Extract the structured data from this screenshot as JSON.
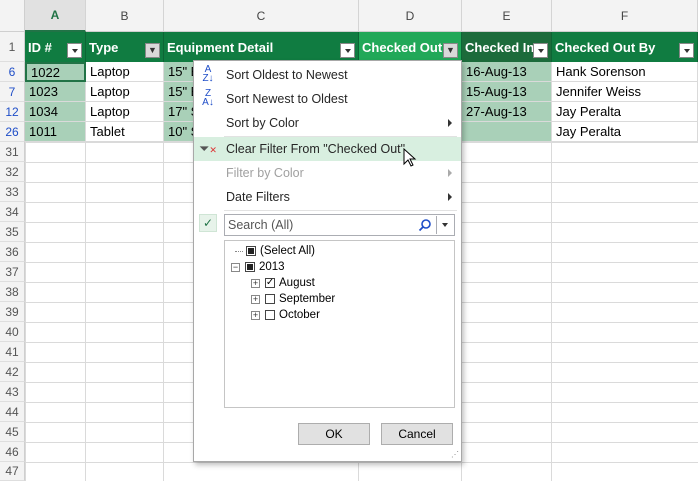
{
  "columns": [
    "A",
    "B",
    "C",
    "D",
    "E",
    "F"
  ],
  "rows": [
    "1",
    "6",
    "7",
    "12",
    "26",
    "31",
    "32",
    "33",
    "34",
    "35",
    "36",
    "37",
    "38",
    "39",
    "40",
    "41",
    "42",
    "43",
    "44",
    "45",
    "46",
    "47"
  ],
  "headers": {
    "id": "ID #",
    "type": "Type",
    "equipment": "Equipment Detail",
    "checked_out": "Checked Out",
    "checked_in": "Checked In",
    "checked_out_by": "Checked Out By"
  },
  "data": [
    {
      "id": "1022",
      "type": "Laptop",
      "equip": "15\" E",
      "in": "16-Aug-13",
      "by": "Hank Sorenson"
    },
    {
      "id": "1023",
      "type": "Laptop",
      "equip": "15\" E",
      "in": "15-Aug-13",
      "by": "Jennifer Weiss"
    },
    {
      "id": "1034",
      "type": "Laptop",
      "equip": "17\" S",
      "in": "27-Aug-13",
      "by": "Jay Peralta"
    },
    {
      "id": "1011",
      "type": "Tablet",
      "equip": "10\" S",
      "in": "",
      "by": "Jay Peralta"
    }
  ],
  "menu": {
    "sort_asc": "Sort Oldest to Newest",
    "sort_desc": "Sort Newest to Oldest",
    "sort_color": "Sort by Color",
    "clear_filter": "Clear Filter From \"Checked Out\"",
    "filter_color": "Filter by Color",
    "date_filters": "Date Filters",
    "search_value": "Search (All)",
    "tree": {
      "select_all": "(Select All)",
      "year": "2013",
      "months": [
        "August",
        "September",
        "October"
      ]
    },
    "ok": "OK",
    "cancel": "Cancel"
  },
  "icons": {
    "sort_asc": "sort-oldest-newest-icon",
    "sort_desc": "sort-newest-oldest-icon",
    "clear": "clear-filter-icon",
    "search": "search-icon"
  },
  "colors": {
    "header_green": "#107c41",
    "selection": "#a9d0b8",
    "hover": "#d8efe0"
  }
}
